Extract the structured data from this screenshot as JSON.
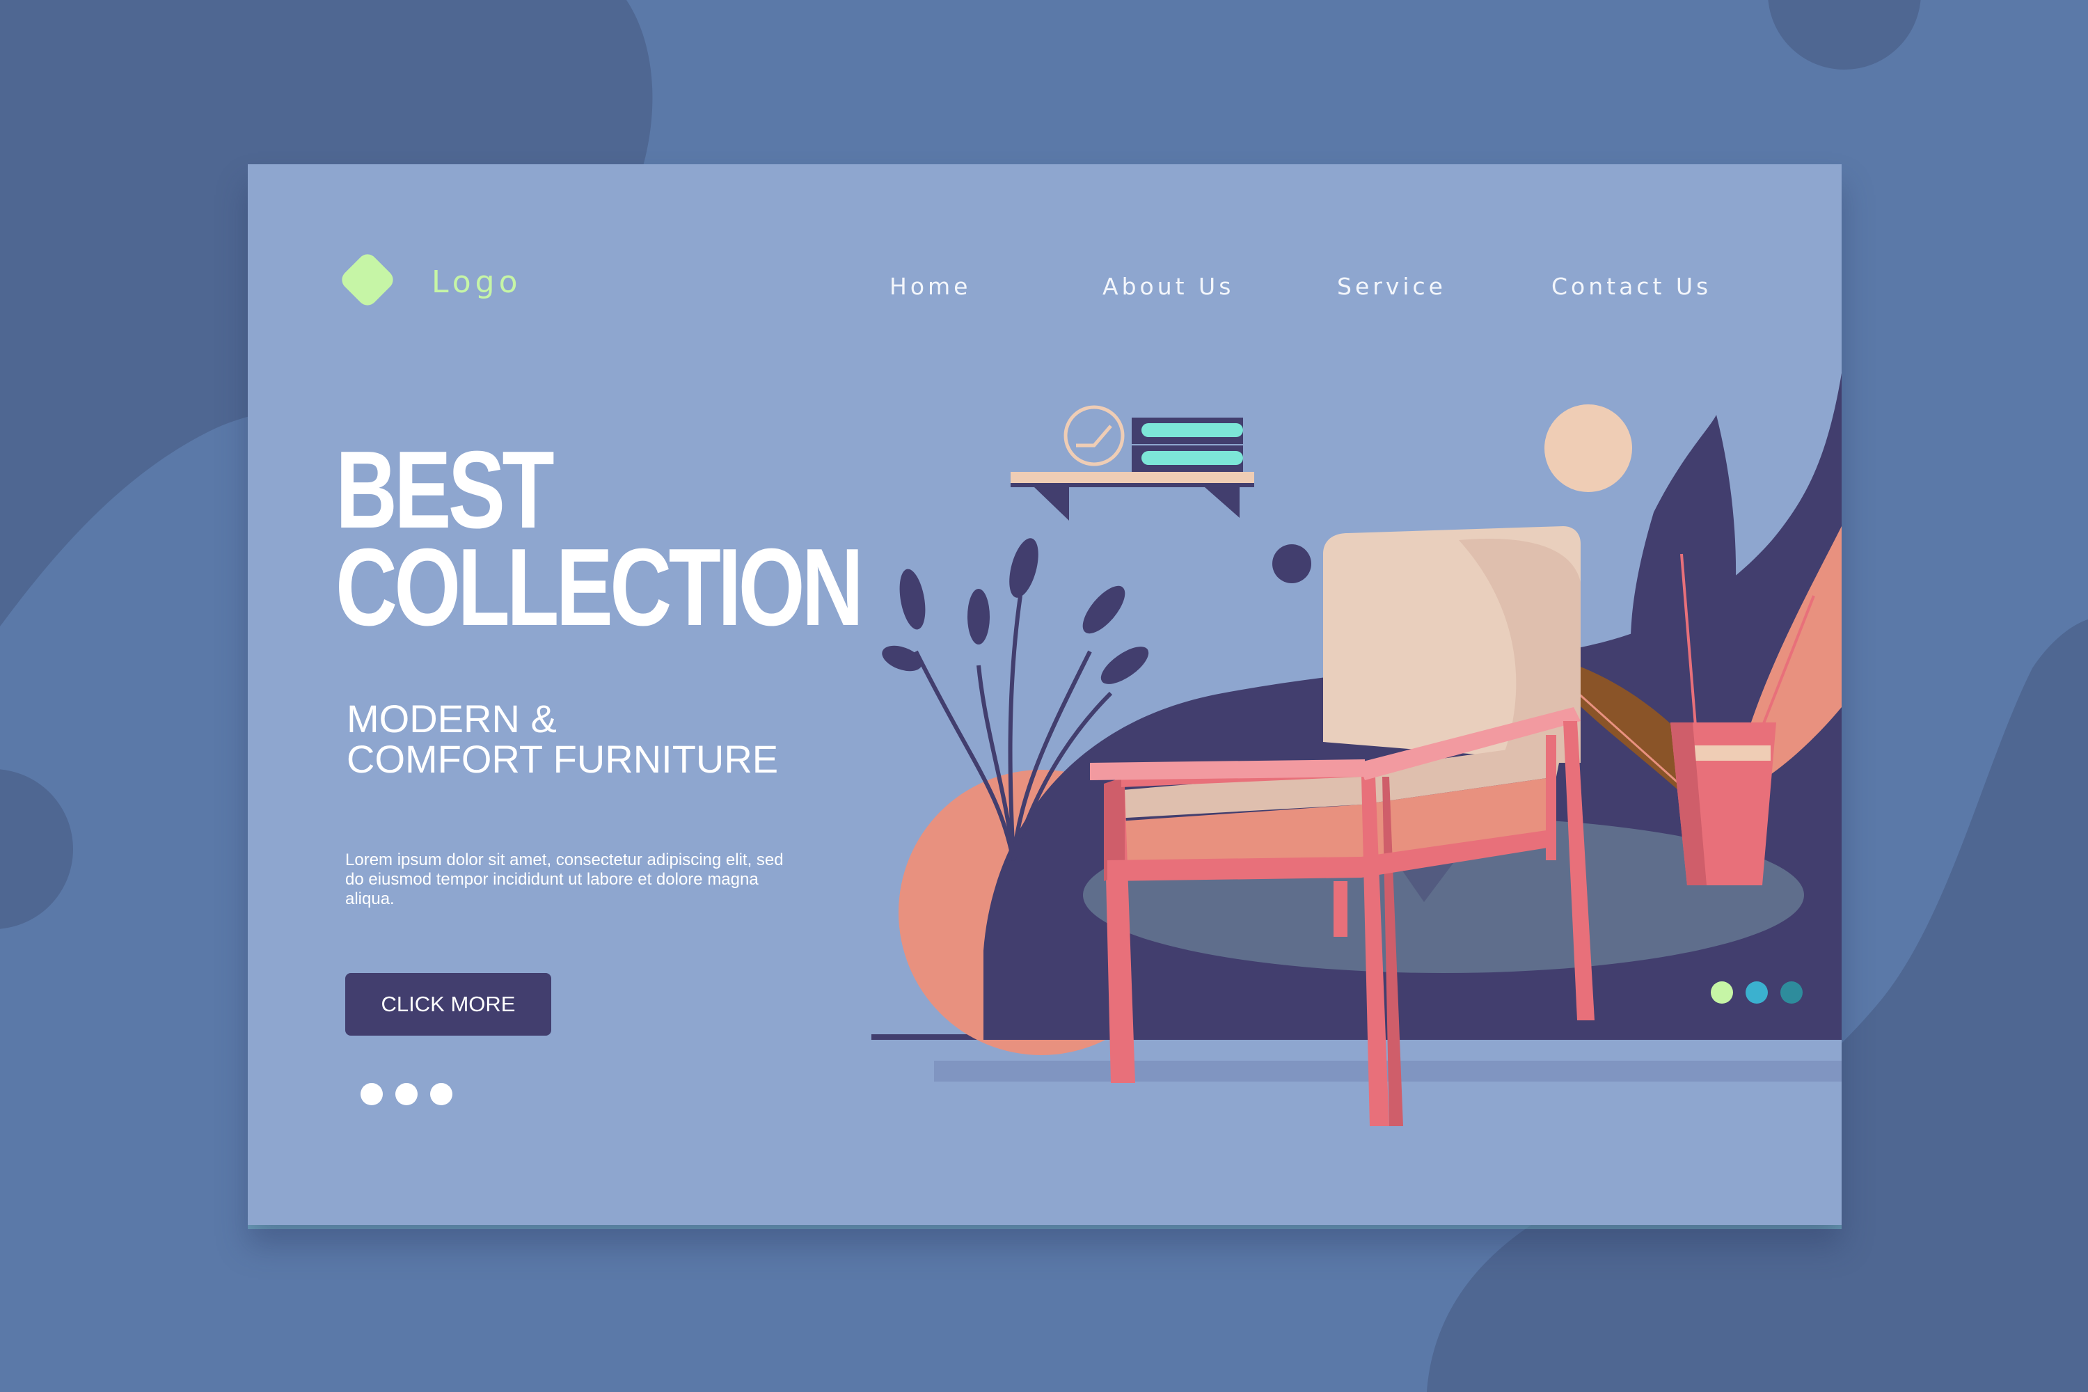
{
  "colors": {
    "page_background": "#5b79a8",
    "card_background": "#8ea6cf",
    "accent_green": "#c6f5a6",
    "button_dark": "#423e6e",
    "chair_pink": "#e8707a",
    "peach": "#e8917f"
  },
  "header": {
    "logo_icon": "diamond-logo-icon",
    "logo_label": "Logo",
    "nav": [
      {
        "label": "Home"
      },
      {
        "label": "About Us"
      },
      {
        "label": "Service"
      },
      {
        "label": "Contact Us"
      }
    ]
  },
  "hero": {
    "title_line1": "BEST",
    "title_line2": "COLLECTION",
    "subtitle_line1": "MODERN &",
    "subtitle_line2": "COMFORT FURNITURE",
    "body": "Lorem ipsum dolor sit amet, consectetur adipiscing elit, sed do eiusmod tempor incididunt ut labore et dolore magna aliqua.",
    "cta_label": "CLICK MORE"
  },
  "carousel": {
    "left_dots": 3,
    "right_dots": [
      "#c6f5a6",
      "#3bb1cf",
      "#2e8c9c"
    ]
  },
  "illustration": {
    "items": [
      "wall-shelf",
      "clock-icon",
      "books-icon",
      "armchair-icon",
      "potted-plant-icon",
      "stem-plant-icon",
      "round-rug"
    ]
  }
}
